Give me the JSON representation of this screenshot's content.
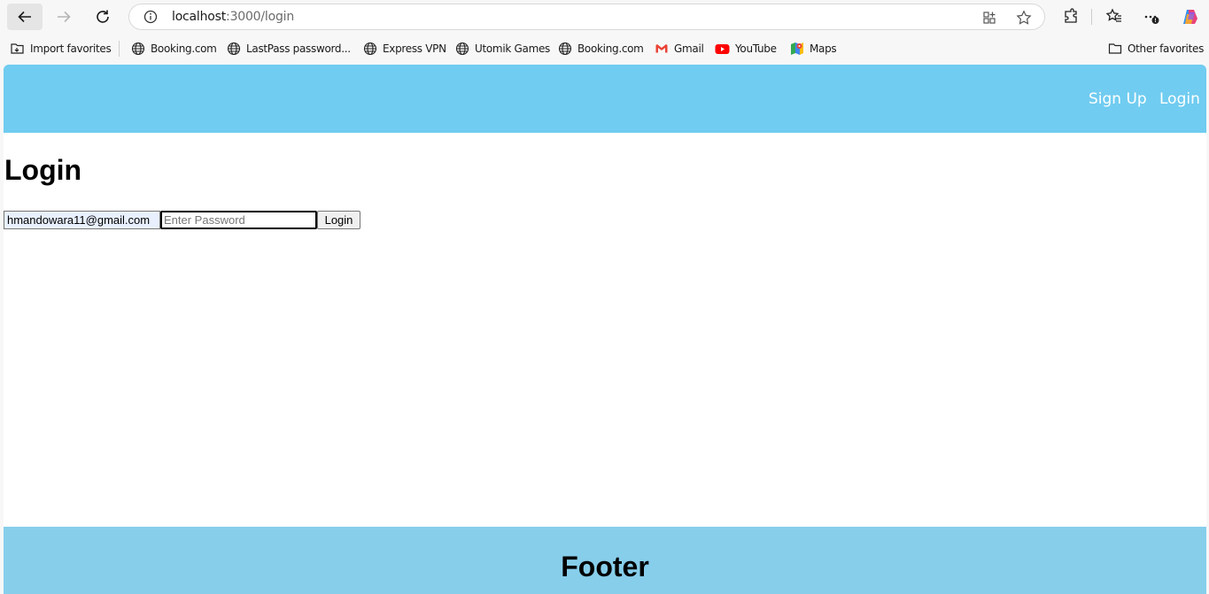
{
  "browser": {
    "url_host": "localhost",
    "url_path": ":3000/login",
    "bookmarks": [
      {
        "label": "Import favorites",
        "icon": "import-icon"
      },
      {
        "label": "Booking.com",
        "icon": "globe-icon"
      },
      {
        "label": "LastPass password...",
        "icon": "globe-icon"
      },
      {
        "label": "Express VPN",
        "icon": "globe-icon"
      },
      {
        "label": "Utomik Games",
        "icon": "globe-icon"
      },
      {
        "label": "Booking.com",
        "icon": "globe-icon"
      },
      {
        "label": "Gmail",
        "icon": "gmail-icon"
      },
      {
        "label": "YouTube",
        "icon": "youtube-icon"
      },
      {
        "label": "Maps",
        "icon": "maps-icon"
      }
    ],
    "other_favorites": "Other favorites"
  },
  "header": {
    "nav": [
      "Sign Up",
      "Login"
    ],
    "color": "#70ccf0"
  },
  "main": {
    "title": "Login",
    "email_value": "hmandowara11@gmail.com",
    "password_placeholder": "Enter Password",
    "submit_label": "Login"
  },
  "footer": {
    "title": "Footer",
    "color": "#87ceeb"
  }
}
